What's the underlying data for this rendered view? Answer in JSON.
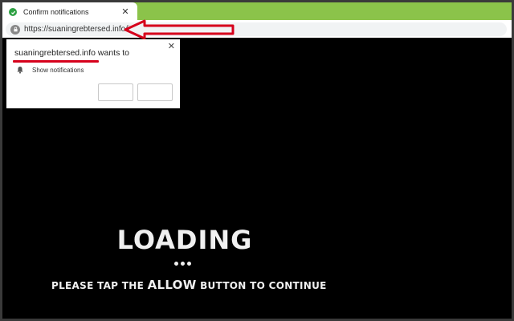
{
  "browser": {
    "tab": {
      "title": "Confirm notifications",
      "close_glyph": "✕",
      "favicon": "check-circle-icon"
    },
    "address_bar": {
      "url": "https://suaningrebtersed.info/i"
    },
    "colors": {
      "tabstrip": "#8bc34a",
      "favicon": "#2ea043",
      "annotation": "#d6001c"
    }
  },
  "prompt": {
    "origin": "suaningrebtersed.info",
    "wants_to": "wants to",
    "permission": "Show notifications",
    "close_glyph": "✕",
    "block_label": "",
    "allow_label": ""
  },
  "page": {
    "loading": "LOADING",
    "instruction_before": "PLEASE TAP THE",
    "instruction_emphasis": "ALLOW",
    "instruction_after": "BUTTON TO CONTINUE"
  }
}
